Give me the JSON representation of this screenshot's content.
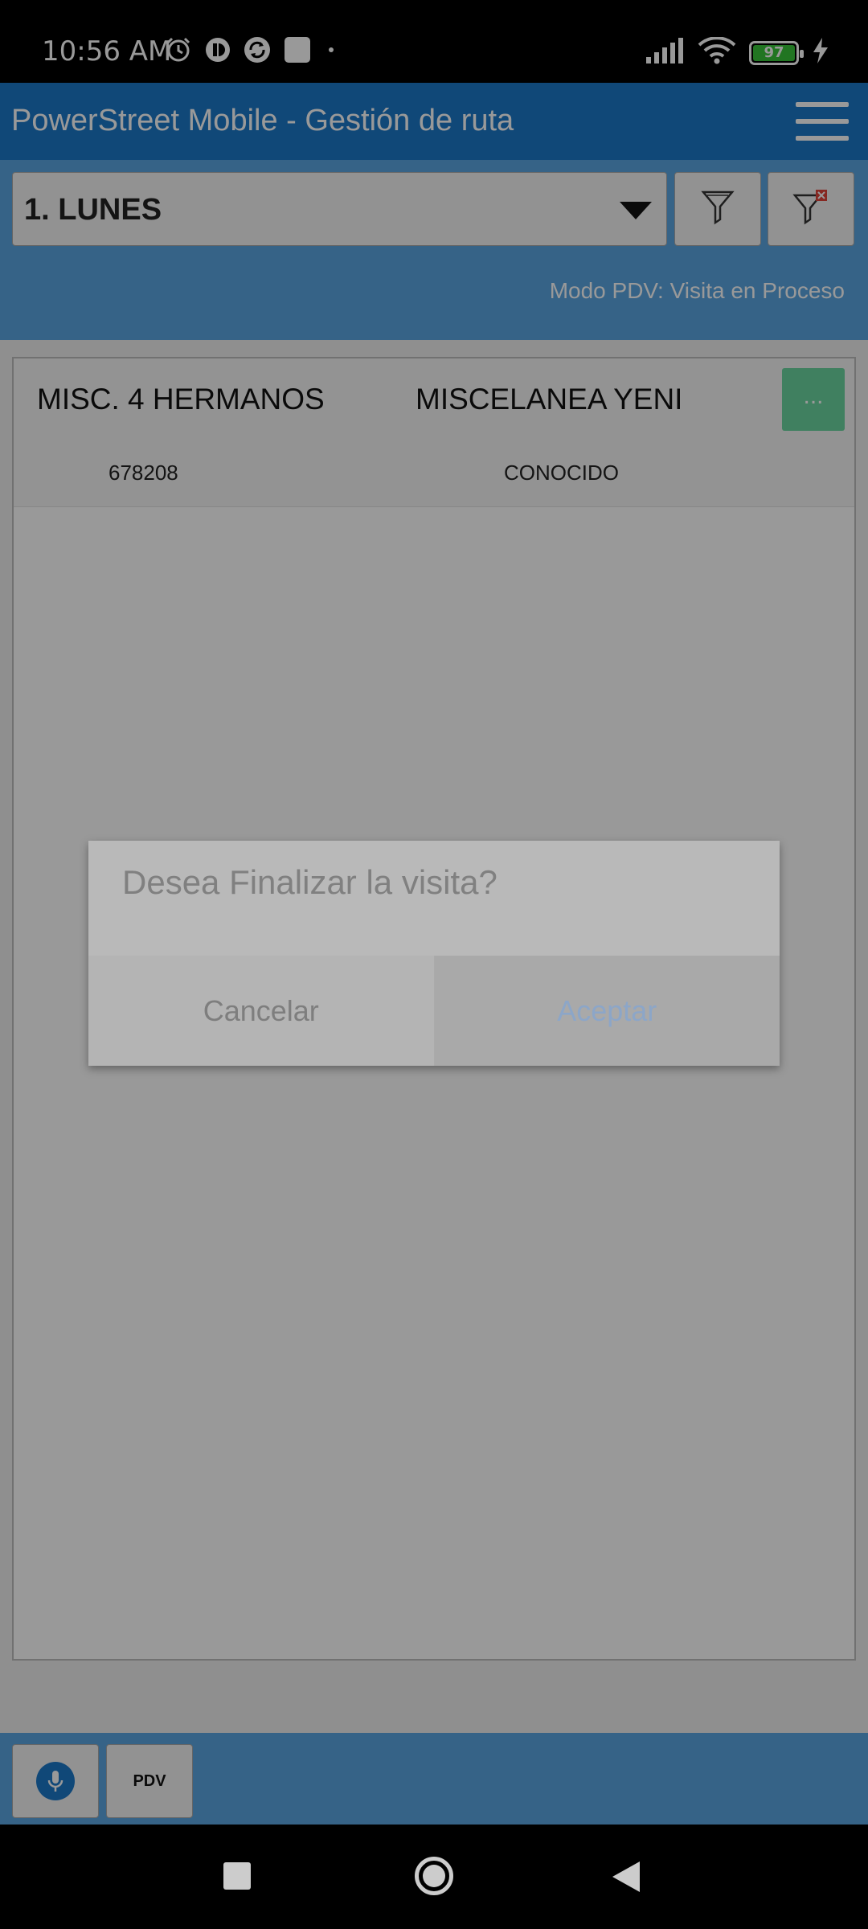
{
  "status_bar": {
    "time": "10:56 AM",
    "battery_level": "97",
    "left_icons": [
      "alarm-icon",
      "app-notification-icon",
      "sync-app-icon",
      "app-square-icon",
      "dot-icon"
    ],
    "right_icons": [
      "signal-icon",
      "wifi-icon",
      "battery-icon",
      "charging-icon"
    ]
  },
  "app_bar": {
    "title": "PowerStreet Mobile - Gestión de ruta",
    "color": "#1b78c9"
  },
  "toolbar": {
    "day_select_value": "1.  LUNES",
    "mode_text": "Modo PDV: Visita en Proceso",
    "filter_icon": "filter-icon",
    "clear_filter_icon": "clear-filter-icon"
  },
  "list": {
    "rows": [
      {
        "name": "MISC. 4 HERMANOS",
        "second_name": "MISCELANEA YENI",
        "code": "678208",
        "status": "CONOCIDO",
        "more_label": "..."
      }
    ]
  },
  "bottom_bar": {
    "mic_icon": "microphone-icon",
    "pdv_label": "PDV"
  },
  "dialog": {
    "message": "Desea Finalizar la visita?",
    "cancel_label": "Cancelar",
    "accept_label": "Aceptar"
  },
  "nav_bar": {
    "icons": [
      "recents-icon",
      "home-icon",
      "back-icon"
    ]
  }
}
